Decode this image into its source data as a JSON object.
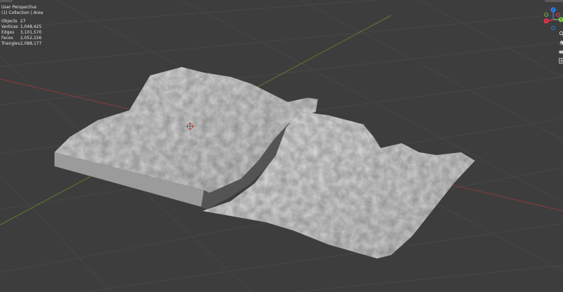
{
  "viewport": {
    "view_name": "User Perspective",
    "collection_label": "(1) Collection | Area",
    "stats": [
      {
        "label": "Objects",
        "value": "27"
      },
      {
        "label": "Vertices",
        "value": "1,048,425"
      },
      {
        "label": "Edges",
        "value": "3,101,570"
      },
      {
        "label": "Faces",
        "value": "2,052,156"
      },
      {
        "label": "Triangles",
        "value": "2,088,177"
      }
    ]
  },
  "gizmo": {
    "axes": [
      {
        "name": "z",
        "label": "Z",
        "color": "#2f83ff"
      },
      {
        "name": "y",
        "label": "Y",
        "color": "#7ac94a"
      },
      {
        "name": "x",
        "label": "X",
        "color": "#ff3352"
      }
    ]
  },
  "tools": [
    "zoom-icon",
    "pan-icon",
    "camera-icon",
    "grid-icon"
  ],
  "colors": {
    "background": "#3d3d3d",
    "grid": "#474747",
    "x_axis": "#8a3b3b",
    "y_axis": "#5e7b2e",
    "terrain": "#c9c9c9"
  }
}
